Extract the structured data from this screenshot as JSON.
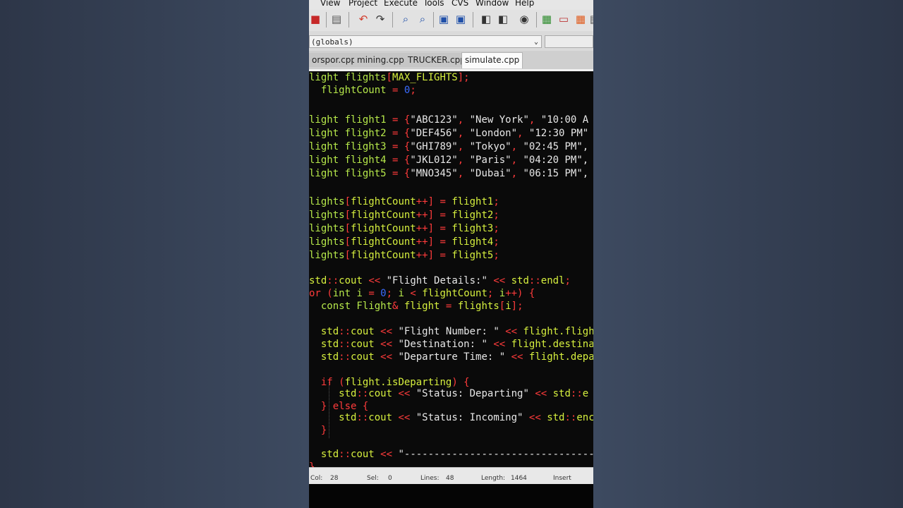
{
  "menu": [
    "View",
    "Project",
    "Execute",
    "Tools",
    "CVS",
    "Window",
    "Help"
  ],
  "scope_select": {
    "value": "(globals)"
  },
  "tabs": [
    {
      "label": "orspor.cpp",
      "active": false
    },
    {
      "label": "mining.cpp",
      "active": false
    },
    {
      "label": "TRUCKER.cpp",
      "active": false
    },
    {
      "label": "simulate.cpp",
      "active": true
    }
  ],
  "code": {
    "l1": {
      "a": "light flights",
      "b": "[",
      "c": "MAX_FLIGHTS",
      "d": "];"
    },
    "l2": {
      "a": "  flightCount ",
      "b": "= ",
      "c": "0",
      "d": ";"
    },
    "flights": [
      {
        "var": "light flight1 ",
        "num": "\"ABC123\"",
        "city": "\"New York\"",
        "time": "\"10:00 A"
      },
      {
        "var": "light flight2 ",
        "num": "\"DEF456\"",
        "city": "\"London\"",
        "time": "\"12:30 PM\""
      },
      {
        "var": "light flight3 ",
        "num": "\"GHI789\"",
        "city": "\"Tokyo\"",
        "time": "\"02:45 PM\","
      },
      {
        "var": "light flight4 ",
        "num": "\"JKL012\"",
        "city": "\"Paris\"",
        "time": "\"04:20 PM\","
      },
      {
        "var": "light flight5 ",
        "num": "\"MNO345\"",
        "city": "\"Dubai\"",
        "time": "\"06:15 PM\","
      }
    ],
    "assign": [
      {
        "a": "lights",
        "b": "[",
        "c": "flightCount",
        "d": "++",
        "e": "] = ",
        "f": "flight1",
        "g": ";"
      },
      {
        "a": "lights",
        "b": "[",
        "c": "flightCount",
        "d": "++",
        "e": "] = ",
        "f": "flight2",
        "g": ";"
      },
      {
        "a": "lights",
        "b": "[",
        "c": "flightCount",
        "d": "++",
        "e": "] = ",
        "f": "flight3",
        "g": ";"
      },
      {
        "a": "lights",
        "b": "[",
        "c": "flightCount",
        "d": "++",
        "e": "] = ",
        "f": "flight4",
        "g": ";"
      },
      {
        "a": "lights",
        "b": "[",
        "c": "flightCount",
        "d": "++",
        "e": "] = ",
        "f": "flight5",
        "g": ";"
      }
    ],
    "cout1": {
      "a": "std",
      "b": "::",
      "c": "cout ",
      "d": "<< ",
      "e": "\"Flight Details:\" ",
      "f": "<< ",
      "g": "std",
      "h": "::",
      "i": "endl",
      "j": ";"
    },
    "for": {
      "a": "or ",
      "b": "(",
      "c": "int i ",
      "d": "= ",
      "e": "0",
      "f": "; ",
      "g": "i ",
      "h": "< ",
      "i": "flightCount",
      "j": "; ",
      "k": "i",
      "l": "++) {"
    },
    "const": {
      "a": "  const Flight",
      "b": "& ",
      "c": "flight ",
      "d": "= ",
      "e": "flights",
      "f": "[",
      "g": "i",
      "h": "];"
    },
    "d1": {
      "a": "  std",
      "b": "::",
      "c": "cout ",
      "d": "<< ",
      "e": "\"Flight Number: \" ",
      "f": "<< ",
      "g": "flight.fligh"
    },
    "d2": {
      "a": "  std",
      "b": "::",
      "c": "cout ",
      "d": "<< ",
      "e": "\"Destination: \" ",
      "f": "<< ",
      "g": "flight.destina"
    },
    "d3": {
      "a": "  std",
      "b": "::",
      "c": "cout ",
      "d": "<< ",
      "e": "\"Departure Time: \" ",
      "f": "<< ",
      "g": "flight.depa"
    },
    "if": {
      "a": "  if ",
      "b": "(",
      "c": "flight.isDeparting",
      "d": ") {"
    },
    "s1": {
      "a": "     std",
      "b": "::",
      "c": "cout ",
      "d": "<< ",
      "e": "\"Status: Departing\" ",
      "f": "<< ",
      "g": "std",
      "h": "::",
      "i": "e"
    },
    "else": {
      "a": "  } ",
      "b": "else",
      "c": " {"
    },
    "s2": {
      "a": "     std",
      "b": "::",
      "c": "cout ",
      "d": "<< ",
      "e": "\"Status: Incoming\" ",
      "f": "<< ",
      "g": "std",
      "h": "::",
      "i": "enc"
    },
    "close": "  }",
    "dash": {
      "a": "  std",
      "b": "::",
      "c": "cout ",
      "d": "<< ",
      "e": "\"-----------------------------------"
    },
    "brace": "}"
  },
  "status": {
    "col_label": "Col:",
    "col": "28",
    "sel_label": "Sel:",
    "sel": "0",
    "lines_label": "Lines:",
    "lines": "48",
    "length_label": "Length:",
    "length": "1464",
    "mode": "Insert"
  },
  "colors": {
    "keyword": "#b6e84a",
    "operator": "#ff3b3b",
    "string": "#e8e8e8",
    "number": "#3a6bff"
  }
}
